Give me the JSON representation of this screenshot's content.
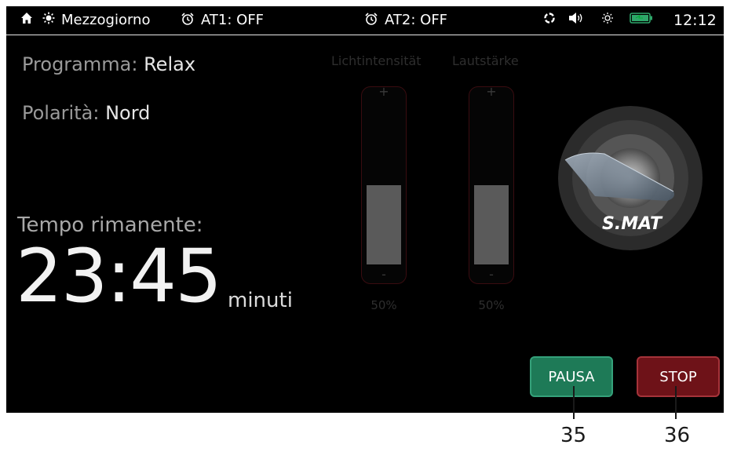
{
  "statusbar": {
    "period": "Mezzogiorno",
    "at1": "AT1: OFF",
    "at2": "AT2: OFF",
    "time": "12:12",
    "icons": [
      "home-icon",
      "sun-icon",
      "alarm-clock-icon",
      "refresh-icon",
      "speaker-icon",
      "brightness-icon",
      "battery-icon"
    ]
  },
  "program": {
    "label": "Programma:",
    "value": "Relax"
  },
  "polarity": {
    "label": "Polarità:",
    "value": "Nord"
  },
  "timer": {
    "label": "Tempo rimanente:",
    "value": "23:45",
    "unit": "minuti"
  },
  "sliders": [
    {
      "title": "Lichtintensität",
      "plus": "+",
      "minus": "-",
      "percent_label": "50%",
      "level": 0.5
    },
    {
      "title": "Lautstärke",
      "plus": "+",
      "minus": "-",
      "percent_label": "50%",
      "level": 0.5
    }
  ],
  "logo": {
    "text": "S.MAT"
  },
  "buttons": {
    "pause": "PAUSA",
    "stop": "STOP"
  },
  "callouts": {
    "pause": "35",
    "stop": "36"
  },
  "colors": {
    "pause_bg": "#1e7a57",
    "stop_bg": "#6e1218",
    "screen_bg": "#000000"
  }
}
